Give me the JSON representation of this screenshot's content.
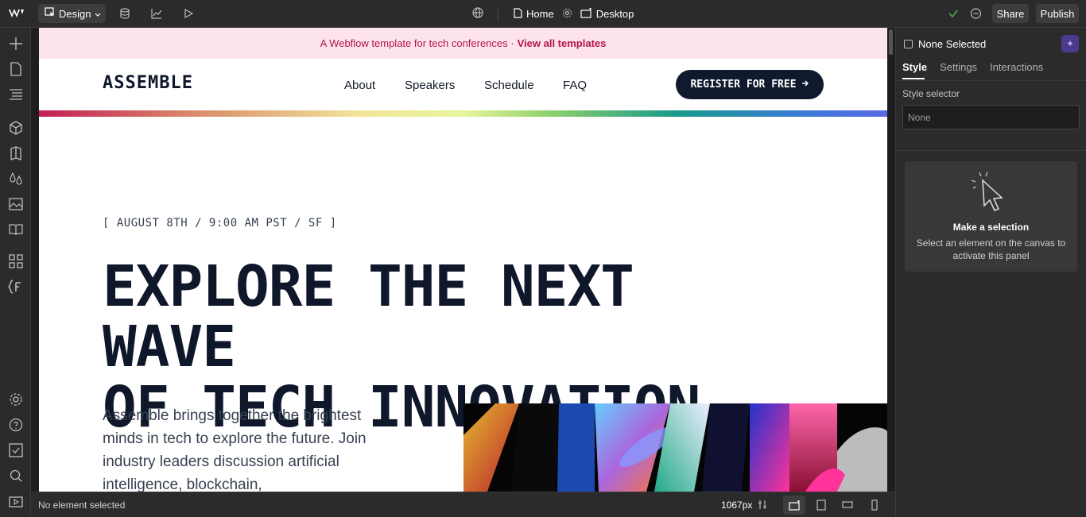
{
  "topbar": {
    "mode_label": "Design",
    "page_name": "Home",
    "breakpoint": "Desktop",
    "share_label": "Share",
    "publish_label": "Publish"
  },
  "canvas": {
    "banner_text": "A Webflow template for tech conferences ·",
    "banner_link": "View all templates",
    "brand": "ASSEMBLE",
    "nav_links": [
      "About",
      "Speakers",
      "Schedule",
      "FAQ"
    ],
    "register_label": "REGISTER FOR FREE",
    "event_line": "[ AUGUST 8TH / 9:00 AM PST / SF ]",
    "hero_line1": "EXPLORE THE NEXT WAVE",
    "hero_line2": "OF TECH INNOVATION",
    "intro_text": "Assemble brings together the brightest minds in tech to explore the future. Join industry leaders discussion artificial intelligence, blockchain,"
  },
  "bottombar": {
    "status": "No element selected",
    "width_readout": "1067px"
  },
  "panel": {
    "selection": "None Selected",
    "tabs": [
      "Style",
      "Settings",
      "Interactions"
    ],
    "style_selector_label": "Style selector",
    "style_selector_value": "None",
    "empty_title": "Make a selection",
    "empty_desc": "Select an element on the canvas to activate this panel"
  }
}
